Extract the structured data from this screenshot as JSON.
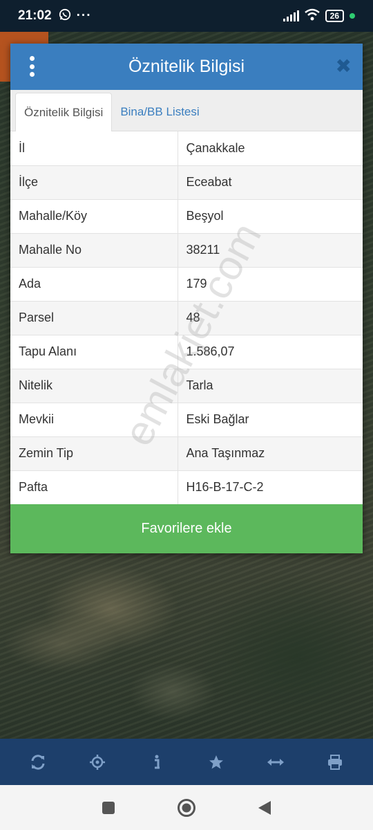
{
  "status_bar": {
    "time": "21:02",
    "battery": "26",
    "whatsapp_icon": "whatsapp-icon",
    "more_icon": "more-notifications-icon"
  },
  "dialog": {
    "title": "Öznitelik Bilgisi",
    "menu_icon": "vertical-dots-icon",
    "close_icon": "close-icon",
    "tabs": [
      {
        "label": "Öznitelik Bilgisi",
        "active": true
      },
      {
        "label": "Bina/BB Listesi",
        "active": false
      }
    ],
    "rows": [
      {
        "key": "İl",
        "value": "Çanakkale"
      },
      {
        "key": "İlçe",
        "value": "Eceabat"
      },
      {
        "key": "Mahalle/Köy",
        "value": "Beşyol"
      },
      {
        "key": "Mahalle No",
        "value": "38211"
      },
      {
        "key": "Ada",
        "value": "179"
      },
      {
        "key": "Parsel",
        "value": "48"
      },
      {
        "key": "Tapu Alanı",
        "value": "1.586,07"
      },
      {
        "key": "Nitelik",
        "value": "Tarla"
      },
      {
        "key": "Mevkii",
        "value": "Eski Bağlar"
      },
      {
        "key": "Zemin Tip",
        "value": "Ana Taşınmaz"
      },
      {
        "key": "Pafta",
        "value": "H16-B-17-C-2"
      }
    ],
    "favorite_button": "Favorilere ekle",
    "watermark": "emlakjet.com"
  },
  "toolbar": {
    "items": [
      "refresh-icon",
      "locate-icon",
      "info-icon",
      "star-icon",
      "measure-icon",
      "print-icon"
    ]
  },
  "colors": {
    "header": "#3a7ebf",
    "favorite_button": "#5cb85c",
    "toolbar": "#1d3f6b",
    "tab_link": "#3a7ebf"
  }
}
